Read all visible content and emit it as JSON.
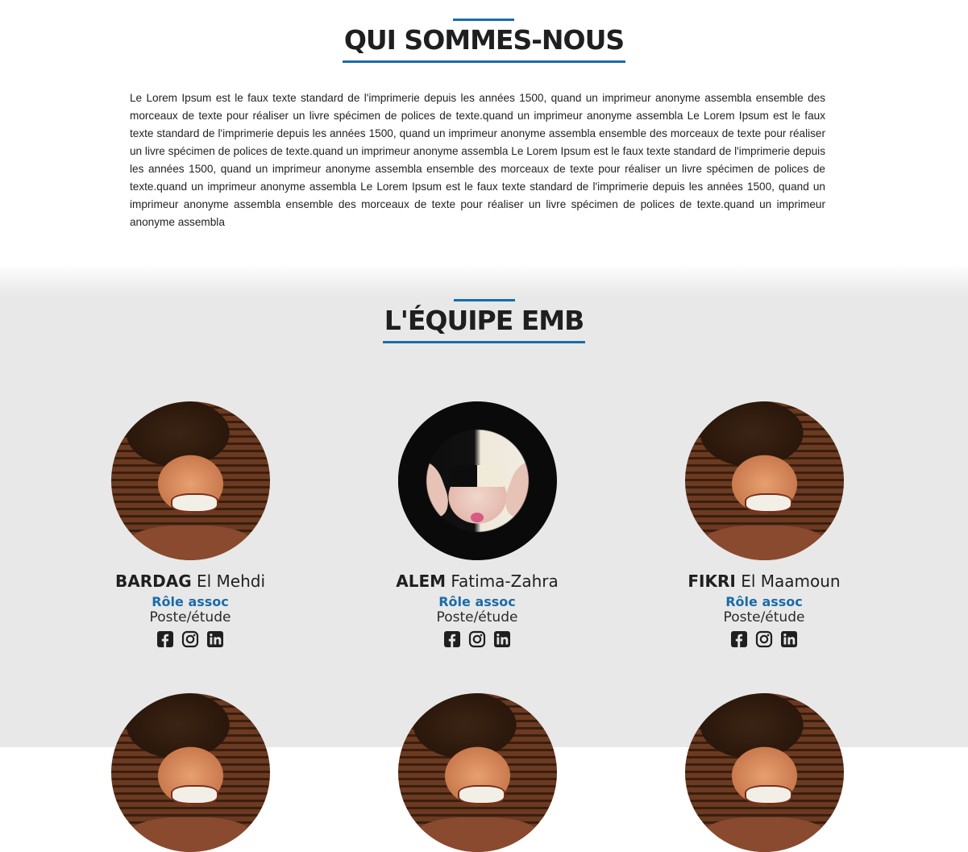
{
  "about": {
    "title": "QUI SOMMES-NOUS",
    "text": "Le Lorem Ipsum est le faux texte standard de l'imprimerie depuis les années 1500, quand un imprimeur anonyme assembla ensemble des morceaux de texte pour réaliser un livre spécimen de polices de texte.quand un imprimeur anonyme assembla Le Lorem Ipsum est le faux texte standard de l'imprimerie depuis les années 1500, quand un imprimeur anonyme assembla ensemble des morceaux de texte pour réaliser un livre spécimen de polices de texte.quand un imprimeur anonyme assembla Le Lorem Ipsum est le faux texte standard de l'imprimerie depuis les années 1500, quand un imprimeur anonyme assembla ensemble des morceaux de texte pour réaliser un livre spécimen de polices de texte.quand un imprimeur anonyme assembla Le Lorem Ipsum est le faux texte standard de l'imprimerie depuis les années 1500, quand un imprimeur anonyme assembla ensemble des morceaux de texte pour réaliser un livre spécimen de polices de texte.quand un imprimeur anonyme assembla"
  },
  "team": {
    "title": "L'ÉQUIPE EMB",
    "members": [
      {
        "last": "BARDAG",
        "first": "El Mehdi",
        "role": "Rôle assoc",
        "post": "Poste/étude"
      },
      {
        "last": "ALEM",
        "first": "Fatima-Zahra",
        "role": "Rôle assoc",
        "post": "Poste/étude"
      },
      {
        "last": "FIKRI",
        "first": "El Maamoun",
        "role": "Rôle assoc",
        "post": "Poste/étude"
      }
    ],
    "socials": [
      "facebook-icon",
      "instagram-icon",
      "linkedin-icon"
    ]
  },
  "colors": {
    "accent": "#1a6ca8",
    "team_bg": "#e8e8e8",
    "text": "#222222"
  }
}
